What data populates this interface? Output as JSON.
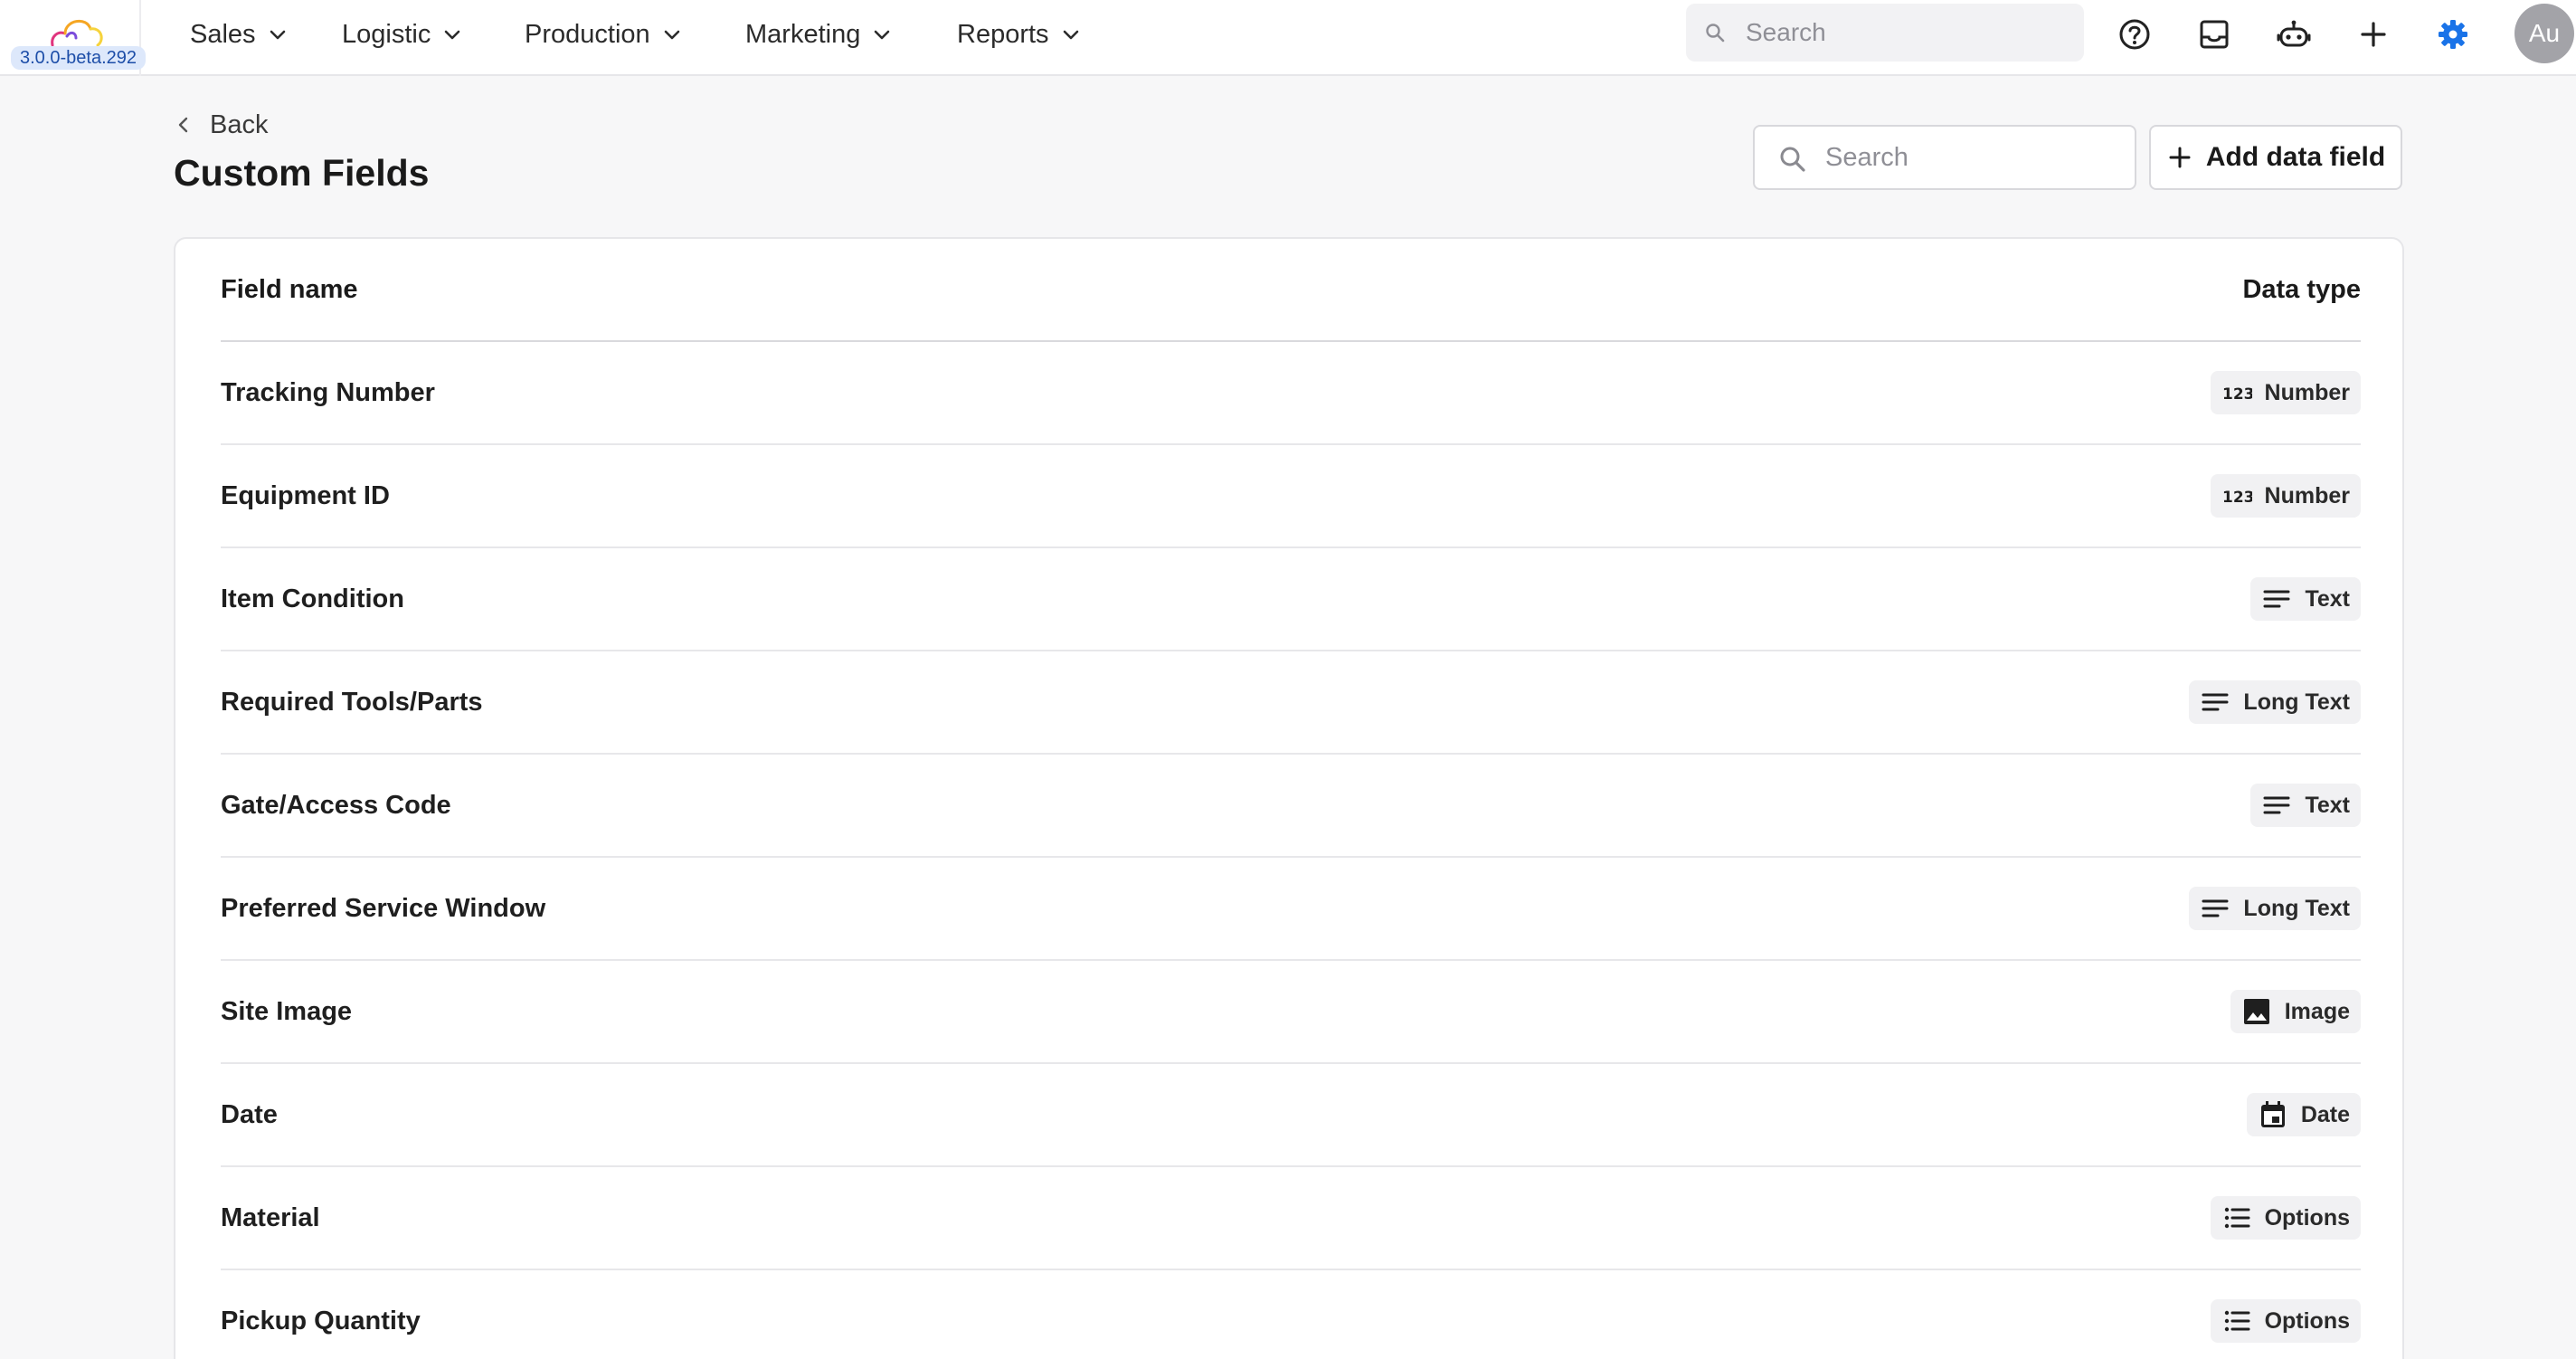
{
  "app": {
    "version": "3.0.0-beta.292",
    "accent_color": "#1a73e8"
  },
  "nav": {
    "items": [
      {
        "label": "Sales"
      },
      {
        "label": "Logistic"
      },
      {
        "label": "Production"
      },
      {
        "label": "Marketing"
      },
      {
        "label": "Reports"
      }
    ],
    "search_placeholder": "Search",
    "icons": [
      "help-icon",
      "inbox-icon",
      "bot-icon",
      "plus-icon",
      "settings-icon"
    ],
    "avatar_initials": "Au"
  },
  "page": {
    "back_label": "Back",
    "title": "Custom Fields",
    "search_placeholder": "Search",
    "add_button_label": "Add data field"
  },
  "table": {
    "columns": {
      "name": "Field name",
      "type": "Data type"
    },
    "rows": [
      {
        "name": "Tracking Number",
        "type": "Number",
        "icon": "number-icon"
      },
      {
        "name": "Equipment ID",
        "type": "Number",
        "icon": "number-icon"
      },
      {
        "name": "Item Condition",
        "type": "Text",
        "icon": "text-icon"
      },
      {
        "name": "Required Tools/Parts",
        "type": "Long Text",
        "icon": "long-text-icon"
      },
      {
        "name": "Gate/Access Code",
        "type": "Text",
        "icon": "text-icon"
      },
      {
        "name": "Preferred Service Window",
        "type": "Long Text",
        "icon": "long-text-icon"
      },
      {
        "name": "Site Image",
        "type": "Image",
        "icon": "image-icon"
      },
      {
        "name": "Date",
        "type": "Date",
        "icon": "calendar-icon"
      },
      {
        "name": "Material",
        "type": "Options",
        "icon": "list-icon"
      },
      {
        "name": "Pickup Quantity",
        "type": "Options",
        "icon": "list-icon"
      }
    ]
  }
}
